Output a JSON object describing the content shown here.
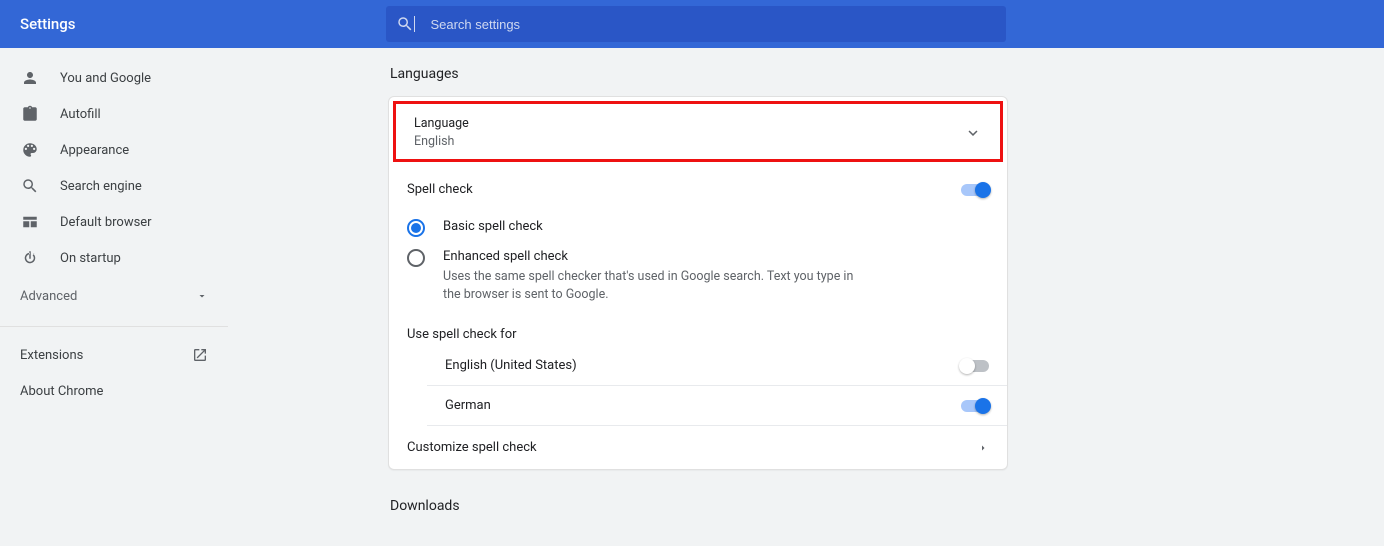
{
  "header": {
    "title": "Settings",
    "search_placeholder": "Search settings"
  },
  "sidebar": {
    "items": [
      {
        "label": "You and Google"
      },
      {
        "label": "Autofill"
      },
      {
        "label": "Appearance"
      },
      {
        "label": "Search engine"
      },
      {
        "label": "Default browser"
      },
      {
        "label": "On startup"
      }
    ],
    "advanced": "Advanced",
    "extensions": "Extensions",
    "about": "About Chrome"
  },
  "sections": {
    "languages_title": "Languages",
    "downloads_title": "Downloads"
  },
  "language_panel": {
    "label": "Language",
    "value": "English"
  },
  "spellcheck": {
    "title": "Spell check",
    "enabled": "on",
    "basic": "Basic spell check",
    "enhanced": "Enhanced spell check",
    "enhanced_desc": "Uses the same spell checker that's used in Google search. Text you type in the browser is sent to Google.",
    "use_for": "Use spell check for",
    "langs": [
      {
        "name": "English (United States)",
        "state": "off"
      },
      {
        "name": "German",
        "state": "on"
      }
    ],
    "customize": "Customize spell check"
  }
}
